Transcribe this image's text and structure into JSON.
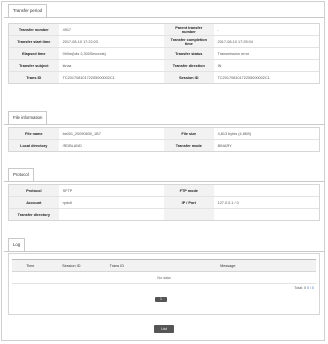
{
  "transfer_period": {
    "tab_label": "Transfer period",
    "rows": [
      {
        "l1": "Transfer number",
        "v1": "4917",
        "l2": "Parent transfer number",
        "v2": "-"
      },
      {
        "l1": "Transfer start time",
        "v1": "2017-08-10 17:22:03",
        "l2": "Transfer completion time",
        "v2": "2017-08-10 17:25:04"
      },
      {
        "l1": "Elapsed time",
        "v1": "0h0m(lots 2,300Seconds)",
        "l2": "Transfer status",
        "v2": "Transmission error"
      },
      {
        "l1": "Transfer subject",
        "v1": "kinaz",
        "l2": "Transfer direction",
        "v2": "IN"
      },
      {
        "l1": "Trans ID",
        "v1": "TC20170810172205000002C1",
        "l2": "Session ID",
        "v2": "TC20170810172205000002C1"
      }
    ]
  },
  "file_information": {
    "tab_label": "File information",
    "rows": [
      {
        "l1": "File name",
        "v1": "bs001_20090830_1B7",
        "l2": "File size",
        "v2": "4,813 bytes (4.8KB)"
      },
      {
        "l1": "Local directory",
        "v1": "/RDBLAND",
        "l2": "Transfer mode",
        "v2": "BINARY"
      }
    ]
  },
  "protocol": {
    "tab_label": "Protocol",
    "rows": [
      {
        "l1": "Protocol",
        "v1": "SFTP",
        "l2": "FTP mode",
        "v2": ""
      },
      {
        "l1": "Account",
        "v1": "rpdctl",
        "l2": "IP / Port",
        "v2": "127.0.0.1 / 0"
      },
      {
        "l1": "Transfer directory",
        "v1": "",
        "l2": "",
        "v2": ""
      }
    ]
  },
  "log": {
    "tab_label": "Log",
    "columns": [
      "Time",
      "Session ID",
      "Trans ID",
      "Message"
    ],
    "empty_text": "No data",
    "total_label": "Total: 0",
    "total_count": "0 / 0",
    "pager_label": "1"
  },
  "list_button": "List"
}
